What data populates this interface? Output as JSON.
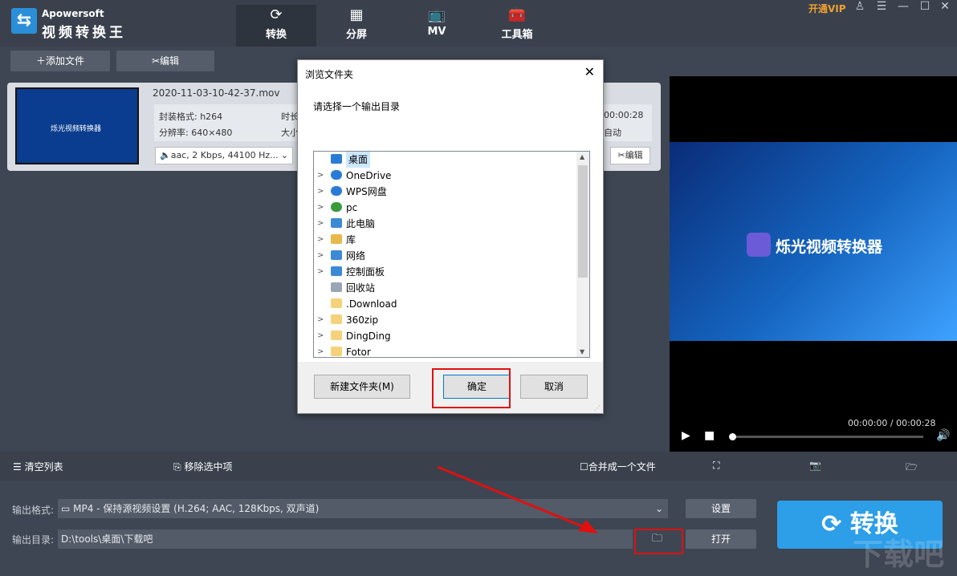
{
  "app": {
    "brand_en": "Apowersoft",
    "brand_cn": "视频转换王",
    "vip": "开通VIP"
  },
  "tabs": [
    {
      "label": "转换",
      "icon": "⟳"
    },
    {
      "label": "分屏",
      "icon": "▦"
    },
    {
      "label": "MV",
      "icon": "📺"
    },
    {
      "label": "工具箱",
      "icon": "🧰"
    }
  ],
  "toolbar": {
    "add_file": "添加文件",
    "edit": "编辑"
  },
  "file": {
    "name": "2020-11-03-10-42-37.mov",
    "format": "封装格式: h264",
    "resolution": "分辨率: 640×480",
    "duration_label": "时长",
    "size_label": "大小",
    "duration_end": "00:00:28",
    "auto": "自动",
    "audio": "aac, 2 Kbps, 44100 Hz...",
    "edit": "编辑",
    "thumb_title": "烁光视频转换器"
  },
  "preview": {
    "title": "烁光视频转换器",
    "time": "00:00:00 / 00:00:28"
  },
  "actions": {
    "clear": "清空列表",
    "remove": "移除选中项",
    "merge": "合并成一个文件"
  },
  "output": {
    "format_label": "输出格式:",
    "format_value": "MP4 - 保持源视频设置 (H.264; AAC, 128Kbps, 双声道)",
    "dir_label": "输出目录:",
    "dir_value": "D:\\tools\\桌面\\下载吧",
    "settings": "设置",
    "open": "打开",
    "convert": "转换"
  },
  "dialog": {
    "title": "浏览文件夹",
    "prompt": "请选择一个输出目录",
    "tree": [
      {
        "label": "桌面",
        "chev": "",
        "color": "#2a7bd6"
      },
      {
        "label": "OneDrive",
        "chev": ">",
        "color": "#2a7bd6"
      },
      {
        "label": "WPS网盘",
        "chev": ">",
        "color": "#2a7bd6"
      },
      {
        "label": "pc",
        "chev": ">",
        "color": "#3a9a3a"
      },
      {
        "label": "此电脑",
        "chev": ">",
        "color": "#3a8ad6"
      },
      {
        "label": "库",
        "chev": ">",
        "color": "#e8b84a"
      },
      {
        "label": "网络",
        "chev": ">",
        "color": "#3a8ad6"
      },
      {
        "label": "控制面板",
        "chev": ">",
        "color": "#3a8ad6"
      },
      {
        "label": "回收站",
        "chev": "",
        "color": "#9aa6b4"
      },
      {
        "label": ".Download",
        "chev": "",
        "color": "#f5d27a"
      },
      {
        "label": "360zip",
        "chev": ">",
        "color": "#f5d27a"
      },
      {
        "label": "DingDing",
        "chev": ">",
        "color": "#f5d27a"
      },
      {
        "label": "Fotor",
        "chev": ">",
        "color": "#f5d27a"
      }
    ],
    "new_folder": "新建文件夹(M)",
    "ok": "确定",
    "cancel": "取消"
  },
  "watermark": "下载吧"
}
